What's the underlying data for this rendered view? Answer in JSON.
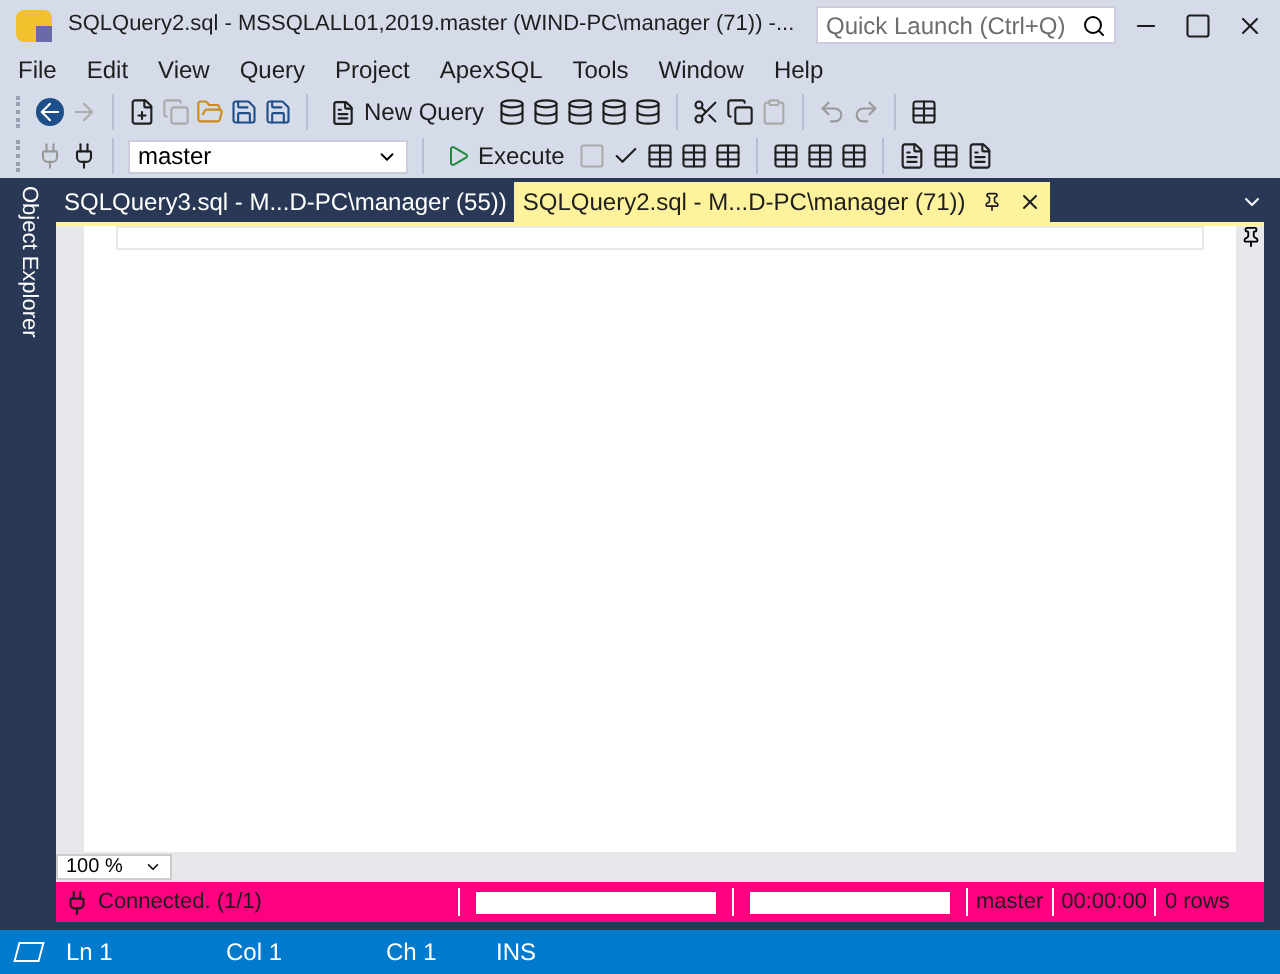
{
  "window": {
    "title": "SQLQuery2.sql - MSSQLALL01,2019.master (WIND-PC\\manager (71)) -...",
    "quick_launch": {
      "placeholder": "Quick Launch (Ctrl+Q)"
    }
  },
  "menu": [
    "File",
    "Edit",
    "View",
    "Query",
    "Project",
    "ApexSQL",
    "Tools",
    "Window",
    "Help"
  ],
  "toolbar": {
    "new_query": "New Query",
    "database": "master",
    "execute": "Execute"
  },
  "side_panel": {
    "label": "Object Explorer"
  },
  "tabs": [
    {
      "label": "SQLQuery3.sql - M...D-PC\\manager (55))",
      "selected": false
    },
    {
      "label": "SQLQuery2.sql - M...D-PC\\manager (71))",
      "selected": true
    }
  ],
  "zoom": "100 %",
  "query_status": {
    "connection": "Connected. (1/1)",
    "database": "master",
    "elapsed": "00:00:00",
    "rows": "0 rows"
  },
  "status_bar": {
    "line": "Ln 1",
    "column": "Col 1",
    "char": "Ch 1",
    "mode": "INS"
  }
}
